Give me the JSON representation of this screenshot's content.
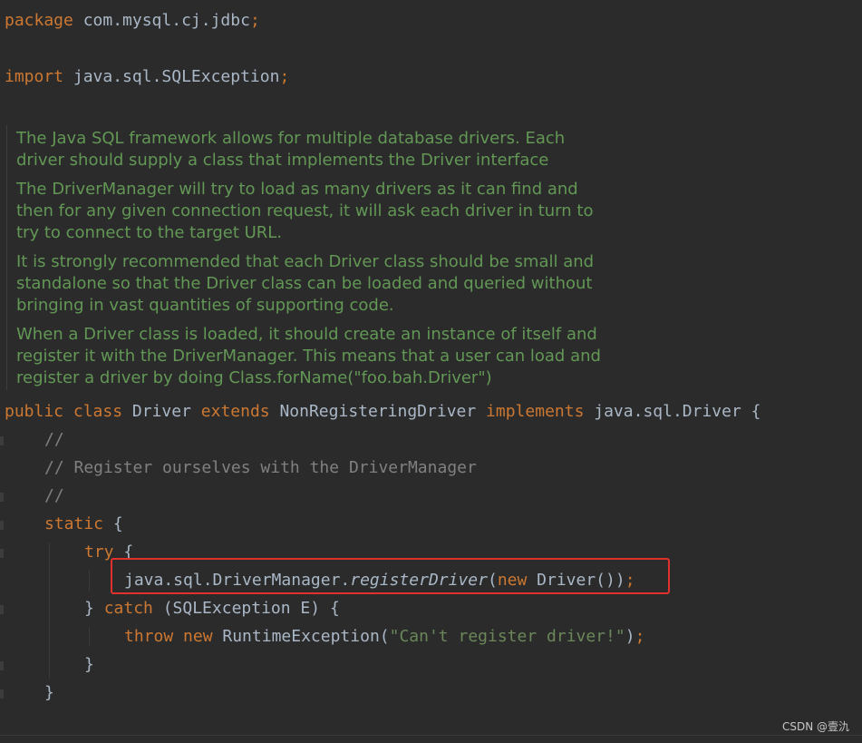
{
  "editor": {
    "line_package": {
      "kw": "package",
      "text": " com.mysql.cj.jdbc",
      "semi": ";"
    },
    "line_import": {
      "kw": "import",
      "text": " java.sql.SQLException",
      "semi": ";"
    },
    "javadoc": [
      "The Java SQL framework allows for multiple database drivers. Each driver should supply a class that implements the Driver interface",
      "The DriverManager will try to load as many drivers as it can find and then for any given connection request, it will ask each driver in turn to try to connect to the target URL.",
      "It is strongly recommended that each Driver class should be small and standalone so that the Driver class can be loaded and queried without bringing in vast quantities of supporting code.",
      "When a Driver class is loaded, it should create an instance of itself and register it with the DriverManager. This means that a user can load and register a driver by doing Class.forName(\"foo.bah.Driver\")"
    ],
    "line_class": {
      "kw1": "public",
      "kw2": "class",
      "name": " Driver ",
      "kw3": "extends",
      "parent": " NonRegisteringDriver ",
      "kw4": "implements",
      "iface": " java.sql.Driver {"
    },
    "comment1": "//",
    "comment2": "// Register ourselves with the DriverManager",
    "comment3": "//",
    "static_kw": "static",
    "static_brace": " {",
    "try_kw": "try",
    "try_brace": " {",
    "register_prefix": "java.sql.DriverManager.",
    "register_method": "registerDriver",
    "register_open": "(",
    "register_new": "new",
    "register_rest": " Driver())",
    "register_semi": ";",
    "catch_open": "} ",
    "catch_kw": "catch",
    "catch_rest": " (SQLException E) {",
    "throw_kw": "throw",
    "throw_new": "new",
    "throw_class": " RuntimeException(",
    "throw_str": "\"Can't register driver!\"",
    "throw_end": ")",
    "throw_semi": ";",
    "close_try": "}",
    "close_static": "}"
  },
  "watermark": "CSDN @壹氿"
}
